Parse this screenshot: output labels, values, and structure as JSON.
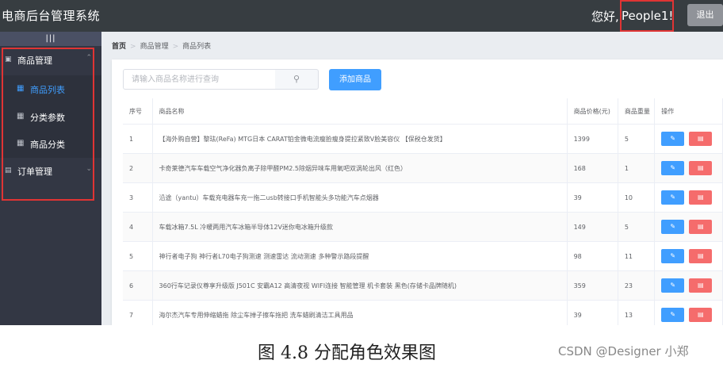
{
  "header": {
    "app_title": "电商后台管理系统",
    "greeting": "您好,",
    "username": "People1!",
    "logout_label": "退出"
  },
  "sidebar": {
    "collapse_label": "|||",
    "menus": [
      {
        "label": "商品管理",
        "icon": "bag-icon",
        "expanded": true,
        "items": [
          {
            "label": "商品列表",
            "icon": "grid-icon",
            "active": true
          },
          {
            "label": "分类参数",
            "icon": "grid-icon",
            "active": false
          },
          {
            "label": "商品分类",
            "icon": "grid-icon",
            "active": false
          }
        ]
      },
      {
        "label": "订单管理",
        "icon": "clipboard-icon",
        "expanded": false,
        "items": []
      }
    ]
  },
  "breadcrumb": {
    "home": "首页",
    "level1": "商品管理",
    "level2": "商品列表"
  },
  "search": {
    "placeholder": "请输入商品名称进行查询",
    "value": ""
  },
  "add_button_label": "添加商品",
  "table": {
    "headers": [
      "序号",
      "商品名称",
      "商品价格(元)",
      "商品重量",
      "操作"
    ],
    "rows": [
      {
        "index": "1",
        "name": "【海外购自营】黎珐(ReFa) MTG日本 CARAT铂金微电流瘦脸瘦身提拉紧致V脸美容仪 【保税仓发货】",
        "price": "1399",
        "weight": "5"
      },
      {
        "index": "2",
        "name": "卡奇莱德汽车车载空气净化器负离子除甲醛PM2.5除烟异味车用氧吧双涡轮出风（红色）",
        "price": "168",
        "weight": "1"
      },
      {
        "index": "3",
        "name": "沿途（yantu）车载充电器车充一拖二usb转接口手机智能头多功能汽车点烟器",
        "price": "39",
        "weight": "10"
      },
      {
        "index": "4",
        "name": "车载冰箱7.5L 冷暖两用汽车冰箱半导体12V迷你电冰箱升级款",
        "price": "149",
        "weight": "5"
      },
      {
        "index": "5",
        "name": "神行者电子狗 神行者L70电子狗测速 测速雷达 流动测速 多种警示路段提醒",
        "price": "98",
        "weight": "11"
      },
      {
        "index": "6",
        "name": "360行车记录仪尊享升级版 J501C 安霸A12 高清夜视 WIFI连接 智能管理 机卡套装 黑色(存储卡品牌随机)",
        "price": "359",
        "weight": "23"
      },
      {
        "index": "7",
        "name": "海尔杰汽车专用伸缩蜡拖 除尘车掸子擦车拖把 洗车蜡刷清洁工具用品",
        "price": "39",
        "weight": "13"
      }
    ],
    "edit_icon": "pencil-icon",
    "delete_icon": "trash-icon"
  },
  "caption": "图 4.8  分配角色效果图",
  "watermark": "CSDN @Designer 小郑",
  "colors": {
    "header_bg": "#373d41",
    "sidebar_bg": "#333744",
    "primary": "#409eff",
    "danger": "#f56c6c",
    "highlight_border": "#e03434"
  }
}
